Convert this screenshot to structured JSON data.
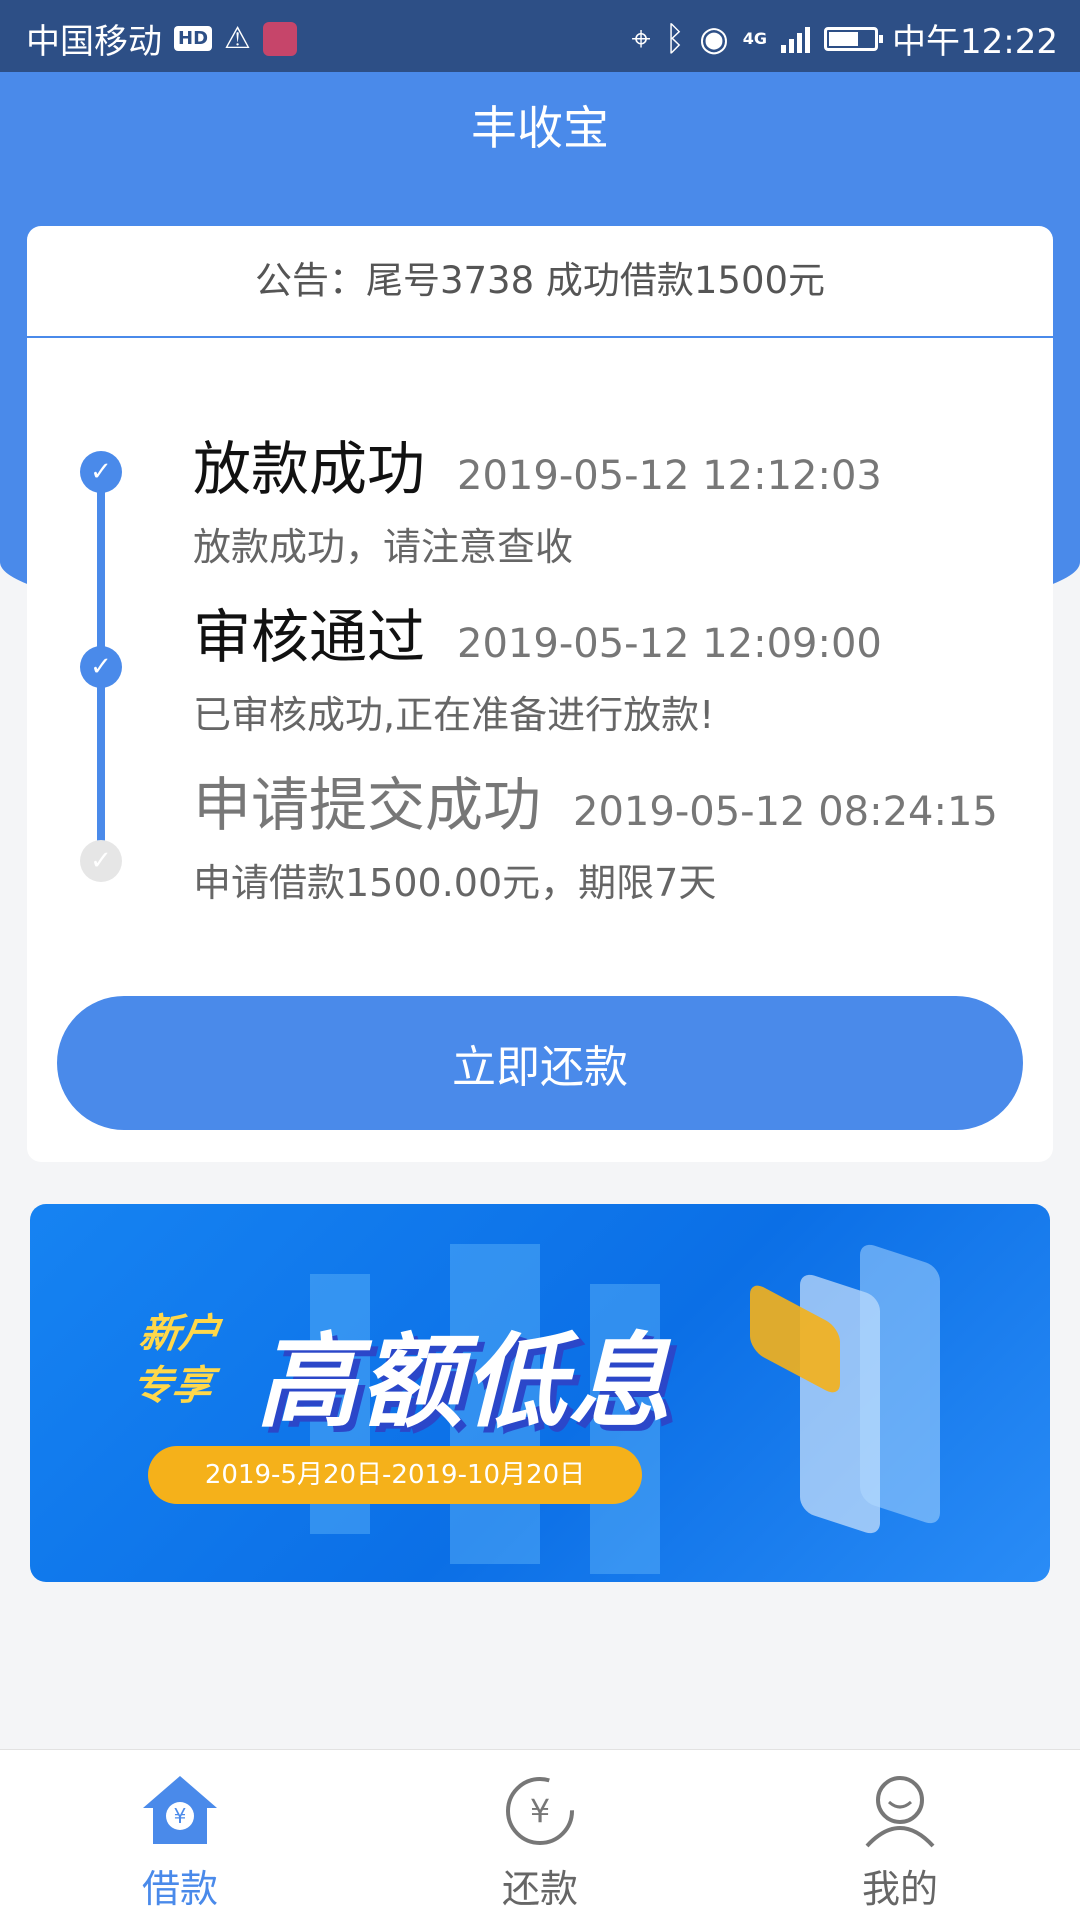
{
  "status_bar": {
    "carrier": "中国移动",
    "hd": "HD",
    "network": "4G",
    "time": "中午12:22",
    "battery_level": 0.65
  },
  "app": {
    "title": "丰收宝"
  },
  "notice": {
    "text": "公告：尾号3738 成功借款1500元"
  },
  "timeline": [
    {
      "title": "放款成功",
      "time": "2019-05-12 12:12:03",
      "desc": "放款成功，请注意查收",
      "status": "done"
    },
    {
      "title": "审核通过",
      "time": "2019-05-12 12:09:00",
      "desc": "已审核成功,正在准备进行放款!",
      "status": "done"
    },
    {
      "title": "申请提交成功",
      "time": "2019-05-12 08:24:15",
      "desc": "申请借款1500.00元，期限7天",
      "status": "pending"
    }
  ],
  "repay_button": {
    "label": "立即还款"
  },
  "banner": {
    "tag_line1": "新户",
    "tag_line2": "专享",
    "headline": "高额低息",
    "date_range": "2019-5月20日-2019-10月20日"
  },
  "bottom_nav": [
    {
      "label": "借款",
      "icon": "house-yen-icon",
      "active": true
    },
    {
      "label": "还款",
      "icon": "yen-refresh-icon",
      "active": false
    },
    {
      "label": "我的",
      "icon": "user-icon",
      "active": false
    }
  ],
  "colors": {
    "accent": "#4a8aea",
    "status_bar": "#2d4f86",
    "banner_date": "#f5b11a",
    "banner_tag": "#ffd84a"
  }
}
